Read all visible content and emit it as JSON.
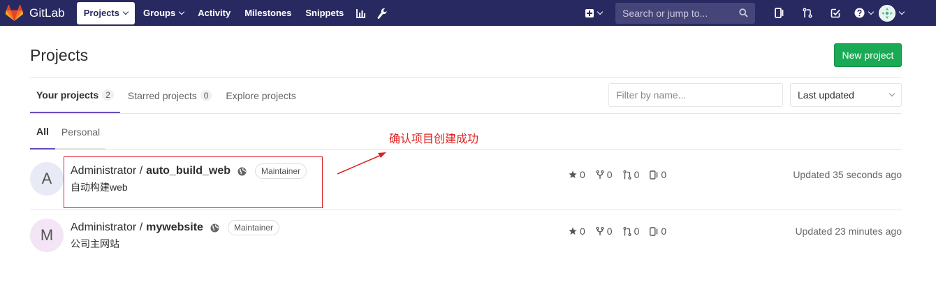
{
  "navbar": {
    "brand": "GitLab",
    "links": [
      {
        "label": "Projects",
        "active": true,
        "dropdown": true
      },
      {
        "label": "Groups",
        "active": false,
        "dropdown": true
      },
      {
        "label": "Activity",
        "active": false,
        "dropdown": false
      },
      {
        "label": "Milestones",
        "active": false,
        "dropdown": false
      },
      {
        "label": "Snippets",
        "active": false,
        "dropdown": false
      }
    ],
    "search_placeholder": "Search or jump to..."
  },
  "page": {
    "title": "Projects",
    "new_project": "New project"
  },
  "tabs": [
    {
      "label": "Your projects",
      "count": "2",
      "active": true
    },
    {
      "label": "Starred projects",
      "count": "0",
      "active": false
    },
    {
      "label": "Explore projects",
      "count": "",
      "active": false
    }
  ],
  "filter_placeholder": "Filter by name...",
  "sort_value": "Last updated",
  "subtabs": [
    {
      "label": "All",
      "active": true
    },
    {
      "label": "Personal",
      "active": false
    }
  ],
  "annotation": "确认项目创建成功",
  "projects": [
    {
      "avatar_letter": "A",
      "avatar_color": "#e8eaf6",
      "namespace": "Administrator /",
      "name": "auto_build_web",
      "role": "Maintainer",
      "description": "自动构建web",
      "stars": "0",
      "forks": "0",
      "merge_requests": "0",
      "issues": "0",
      "updated": "Updated 35 seconds ago"
    },
    {
      "avatar_letter": "M",
      "avatar_color": "#f3e5f5",
      "namespace": "Administrator /",
      "name": "mywebsite",
      "role": "Maintainer",
      "description": "公司主网站",
      "stars": "0",
      "forks": "0",
      "merge_requests": "0",
      "issues": "0",
      "updated": "Updated 23 minutes ago"
    }
  ]
}
